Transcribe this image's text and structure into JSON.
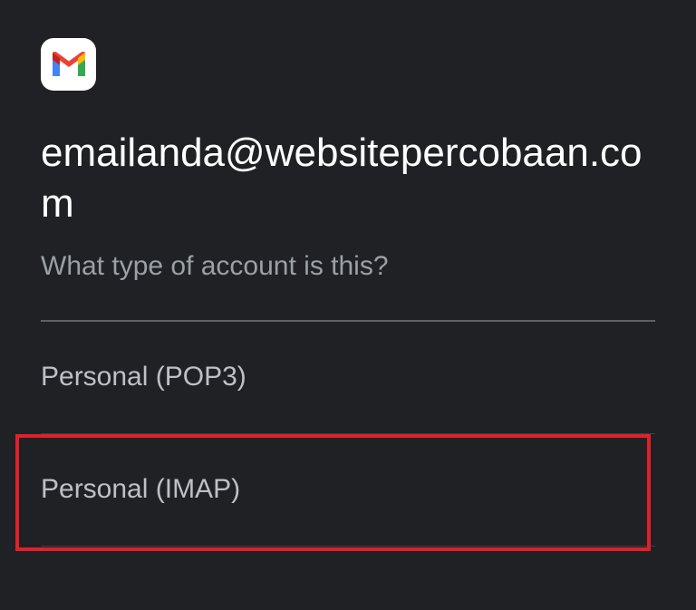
{
  "app": {
    "logo_icon": "gmail-icon",
    "brand_colors": {
      "blue": "#4285F4",
      "red": "#EA4335",
      "yellow": "#FBBC04",
      "green": "#34A853"
    }
  },
  "header": {
    "email": "emailanda@websitepercobaan.com",
    "question": "What type of account is this?"
  },
  "options": [
    {
      "label": "Personal (POP3)"
    },
    {
      "label": "Personal (IMAP)",
      "highlighted": true
    }
  ],
  "annotation": {
    "highlight_color": "#E0202A"
  }
}
